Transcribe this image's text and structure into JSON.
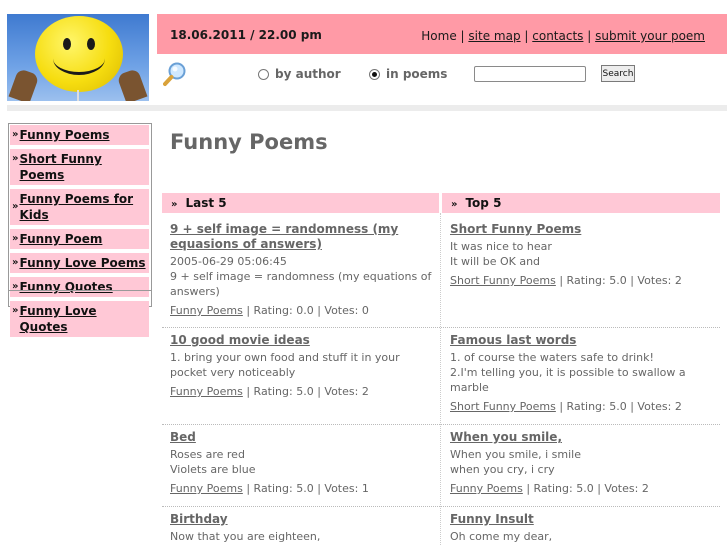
{
  "header": {
    "date": "18.06.2011 / 22.00 pm",
    "links": [
      {
        "label": "Home"
      },
      {
        "label": "site map"
      },
      {
        "label": "contacts"
      },
      {
        "label": "submit your poem"
      }
    ],
    "separator": "|",
    "colors": {
      "topbar": "#ff9aa6",
      "accent": "#ffc8d6"
    }
  },
  "search": {
    "icon": "magnifier-icon",
    "options": [
      {
        "label": "by author",
        "selected": false
      },
      {
        "label": "in poems",
        "selected": true
      }
    ],
    "value": "",
    "button": "Search"
  },
  "sidebar": {
    "marker": "»",
    "items": [
      {
        "label": "Funny Poems"
      },
      {
        "label": "Short Funny Poems"
      },
      {
        "label": "Funny Poems for Kids"
      },
      {
        "label": "Funny Poem"
      },
      {
        "label": "Funny Love Poems"
      },
      {
        "label": "Funny Quotes"
      },
      {
        "label": "Funny Love Quotes"
      }
    ]
  },
  "main": {
    "title": "Funny Poems",
    "marker": "»",
    "columns": [
      {
        "heading": "Last 5"
      },
      {
        "heading": "Top 5"
      }
    ],
    "last5": [
      {
        "title": "9 + self image = randomness (my equasions of answers)",
        "lines": [
          "2005-06-29 05:06:45",
          "9 + self image = randomness (my equations of answers)"
        ],
        "category": "Funny Poems",
        "rating": " | Rating: 0.0 | Votes: 0"
      },
      {
        "title": "10 good movie ideas",
        "lines": [
          "1. bring your own food and stuff it in your pocket very noticeably"
        ],
        "category": "Funny Poems",
        "rating": " | Rating: 5.0 | Votes: 2"
      },
      {
        "title": "Bed",
        "lines": [
          "Roses are red",
          "Violets are blue"
        ],
        "category": "Funny Poems",
        "rating": " | Rating: 5.0 | Votes: 1"
      },
      {
        "title": "Birthday",
        "lines": [
          "Now that you are eighteen,"
        ]
      }
    ],
    "top5": [
      {
        "title": "Short Funny Poems",
        "lines": [
          "It was nice to hear",
          "It will be OK and"
        ],
        "category": "Short Funny Poems",
        "rating": " | Rating: 5.0 | Votes: 2"
      },
      {
        "title": "Famous last words",
        "lines": [
          "1. of course the waters safe to drink!",
          "2.I'm telling you, it is possible to swallow a marble"
        ],
        "category": "Short Funny Poems",
        "rating": " | Rating: 5.0 | Votes: 2"
      },
      {
        "title": "When you smile,",
        "lines": [
          "When you smile, i smile",
          "when you cry, i cry"
        ],
        "category": "Funny Poems",
        "rating": " | Rating: 5.0 | Votes: 2"
      },
      {
        "title": "Funny Insult",
        "lines": [
          "Oh come my dear,"
        ]
      }
    ]
  }
}
